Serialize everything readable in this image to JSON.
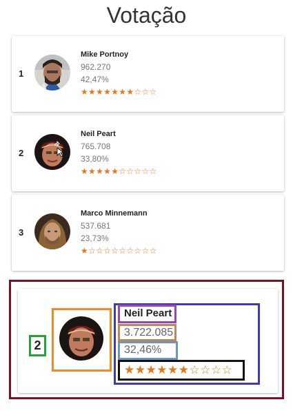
{
  "page": {
    "title": "Votação"
  },
  "ranking": [
    {
      "rank": "1",
      "name": "Mike Portnoy",
      "votes": "962.270",
      "percent": "42,47%",
      "stars": "★★★★★★★☆☆☆",
      "rating": 7,
      "avatar": "mike-portnoy-photo"
    },
    {
      "rank": "2",
      "name": "Neil Peart",
      "votes": "765.708",
      "percent": "33,80%",
      "stars": "★★★★★☆☆☆☆☆",
      "rating": 5,
      "avatar": "neil-peart-photo"
    },
    {
      "rank": "3",
      "name": "Marco Minnemann",
      "votes": "537.681",
      "percent": "23,73%",
      "stars": "★☆☆☆☆☆☆☆☆☆",
      "rating": 1,
      "avatar": "marco-minnemann-photo"
    }
  ],
  "detail": {
    "rank": "2",
    "name": "Neil Peart",
    "votes": "3.722.085",
    "percent": "32,46%",
    "stars": "★★★★★★☆☆☆☆",
    "rating": 6,
    "avatar": "neil-peart-photo"
  },
  "colors": {
    "star": "#e0791c",
    "outer_frame": "#800e1c",
    "rank_box": "#22a33a",
    "avatar_box": "#f18a24",
    "info_box": "#3f3bb5",
    "name_box": "#9a43bb",
    "votes_box": "#c28655",
    "percent_box": "#6c94c6",
    "stars_box": "#111111"
  }
}
